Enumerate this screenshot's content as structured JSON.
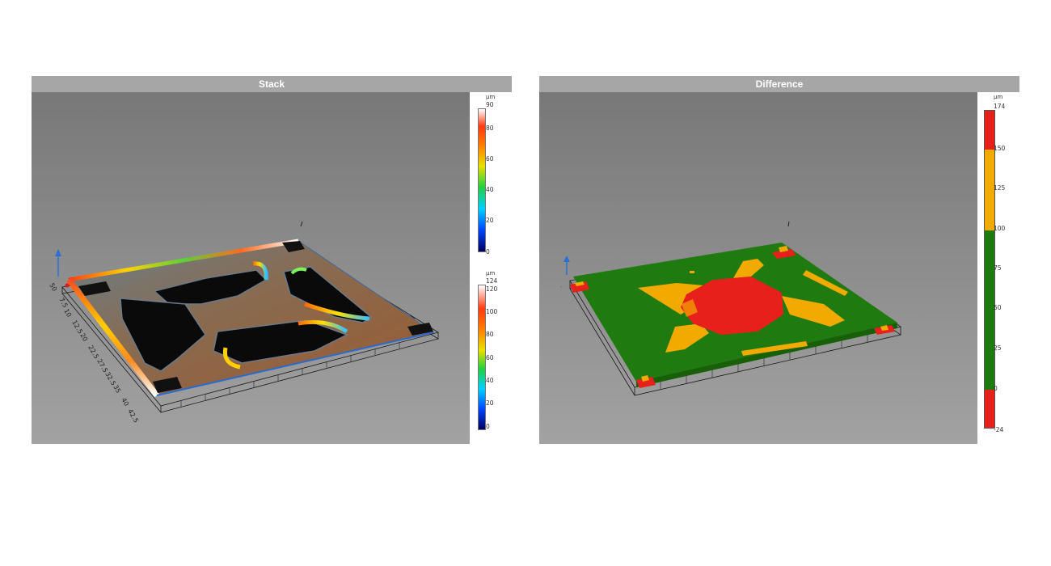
{
  "panels": [
    {
      "title": "Stack",
      "colorbars": [
        {
          "unit": "µm",
          "ticks": [
            "90",
            "80",
            "60",
            "40",
            "20",
            "0"
          ]
        },
        {
          "unit": "µm",
          "ticks": [
            "124",
            "120",
            "100",
            "80",
            "60",
            "40",
            "20",
            "0"
          ]
        }
      ],
      "axis_labels": [
        "50",
        "7.5",
        "10",
        "12.5",
        "20",
        "22.5",
        "27.5",
        "32.5",
        "35",
        "40",
        "42.5"
      ]
    },
    {
      "title": "Difference",
      "colorbar": {
        "unit": "µm",
        "ticks": [
          "174",
          "150",
          "125",
          "100",
          "75",
          "50",
          "25",
          "0",
          "-24"
        ],
        "bands": [
          {
            "from": 150,
            "to": 174,
            "color": "#e8201c"
          },
          {
            "from": 100,
            "to": 150,
            "color": "#f2a900"
          },
          {
            "from": 0,
            "to": 100,
            "color": "#1f7a10"
          },
          {
            "from": -24,
            "to": 0,
            "color": "#e8201c"
          }
        ]
      }
    }
  ],
  "colors": {
    "title_bar": "#a6a6a6",
    "view_background_top": "#7a7a7a",
    "view_background_bottom": "#a3a3a3",
    "green": "#1f7a10",
    "orange": "#f2a900",
    "red": "#e8201c"
  }
}
